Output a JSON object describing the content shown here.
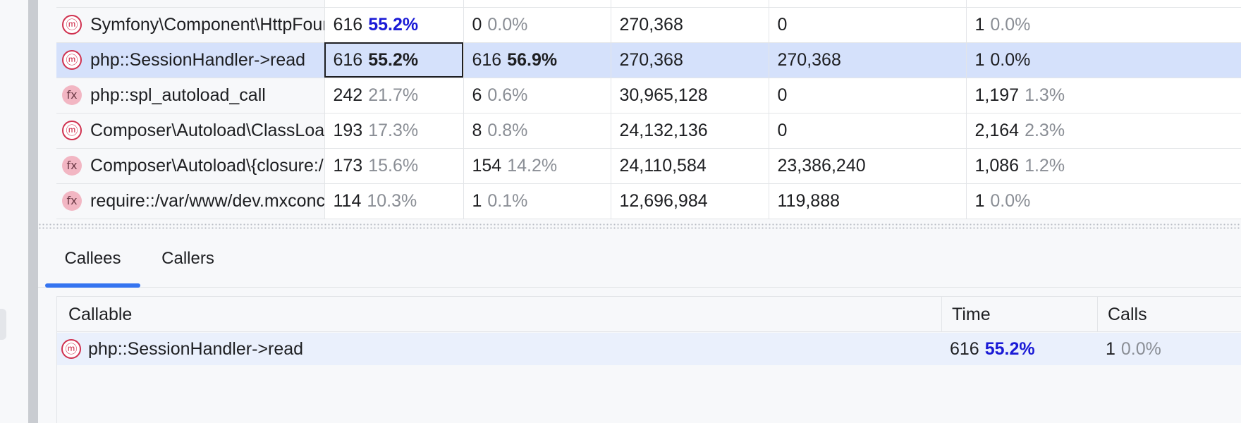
{
  "profiler_table": {
    "rows": [
      {
        "name": "Symfony\\Component\\HttpFoun",
        "icon": "method-icon",
        "time": "616",
        "time_pct": "55.2%",
        "own_time": "0",
        "own_pct": "0.0%",
        "memory": "270,368",
        "own_memory": "0",
        "calls": "1",
        "calls_pct": "0.0%"
      },
      {
        "name": "php::SessionHandler->read",
        "icon": "method-icon",
        "time": "616",
        "time_pct": "55.2%",
        "own_time": "616",
        "own_pct": "56.9%",
        "memory": "270,368",
        "own_memory": "270,368",
        "calls": "1",
        "calls_pct": "0.0%"
      },
      {
        "name": "php::spl_autoload_call",
        "icon": "function-icon",
        "time": "242",
        "time_pct": "21.7%",
        "own_time": "6",
        "own_pct": "0.6%",
        "memory": "30,965,128",
        "own_memory": "0",
        "calls": "1,197",
        "calls_pct": "1.3%"
      },
      {
        "name": "Composer\\Autoload\\ClassLoad",
        "icon": "method-icon",
        "time": "193",
        "time_pct": "17.3%",
        "own_time": "8",
        "own_pct": "0.8%",
        "memory": "24,132,136",
        "own_memory": "0",
        "calls": "2,164",
        "calls_pct": "2.3%"
      },
      {
        "name": "Composer\\Autoload\\{closure:/",
        "icon": "function-icon",
        "time": "173",
        "time_pct": "15.6%",
        "own_time": "154",
        "own_pct": "14.2%",
        "memory": "24,110,584",
        "own_memory": "23,386,240",
        "calls": "1,086",
        "calls_pct": "1.2%"
      },
      {
        "name": "require::/var/www/dev.mxconc",
        "icon": "function-icon",
        "time": "114",
        "time_pct": "10.3%",
        "own_time": "1",
        "own_pct": "0.1%",
        "memory": "12,696,984",
        "own_memory": "119,888",
        "calls": "1",
        "calls_pct": "0.0%"
      }
    ]
  },
  "icons": {
    "method_glyph": "ⓜ",
    "function_glyph": "fx"
  },
  "tabs": [
    {
      "label": "Callees",
      "active": true
    },
    {
      "label": "Callers",
      "active": false
    }
  ],
  "callees": {
    "columns": {
      "callable": "Callable",
      "time": "Time",
      "calls": "Calls"
    },
    "rows": [
      {
        "name": "php::SessionHandler->read",
        "time": "616",
        "time_pct": "55.2%",
        "calls": "1",
        "calls_pct": "0.0%"
      }
    ]
  },
  "colors": {
    "accent": "#3574f0",
    "hot_percent": "#1a1ad6",
    "method_icon": "#d0314f",
    "function_icon_bg": "#f2b6c3",
    "selected_row": "#d5e1fb"
  }
}
